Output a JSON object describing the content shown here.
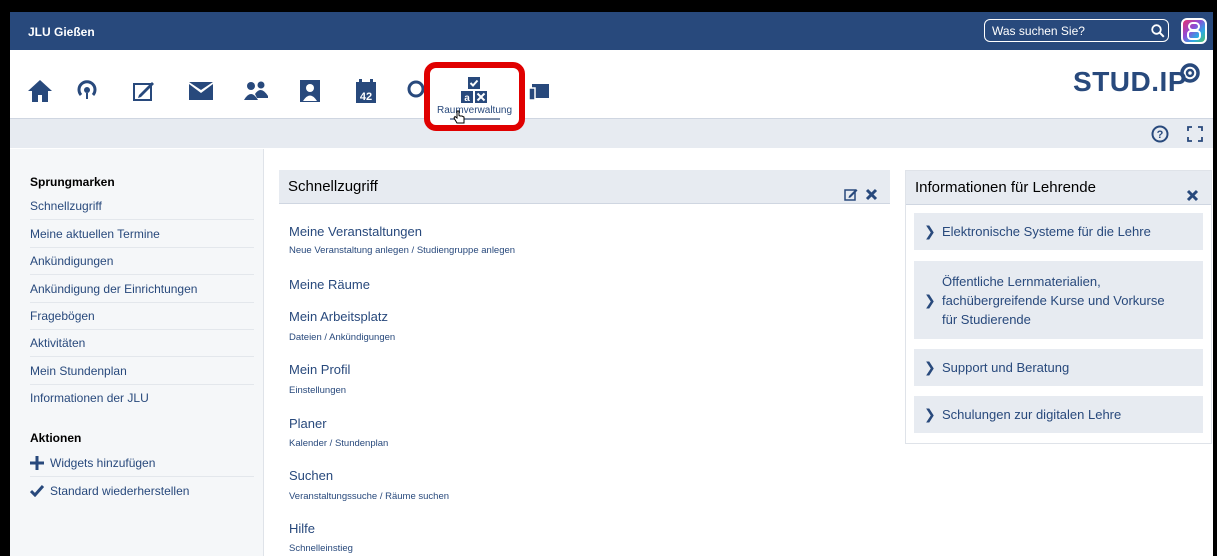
{
  "topbar": {
    "brand": "JLU Gießen",
    "search_placeholder": "Was suchen Sie?"
  },
  "nav": {
    "icons": [
      "home-icon",
      "activity-icon",
      "courses-icon",
      "messages-icon",
      "community-icon",
      "profile-icon",
      "planner-icon",
      "search-icon",
      "resources-icon",
      "tools-icon"
    ],
    "highlighted_label": "Raumverwaltung"
  },
  "logo": {
    "text_a": "STUD",
    "text_b": ".IP"
  },
  "colors": {
    "primary": "#28497c",
    "highlight": "#e00000",
    "panel": "#e7ebf1"
  },
  "sidebar": {
    "jump_heading": "Sprungmarken",
    "jump_items": [
      "Schnellzugriff",
      "Meine aktuellen Termine",
      "Ankündigungen",
      "Ankündigung der Einrichtungen",
      "Fragebögen",
      "Aktivitäten",
      "Mein Stundenplan",
      "Informationen der JLU"
    ],
    "actions_heading": "Aktionen",
    "actions": [
      "Widgets hinzufügen",
      "Standard wiederherstellen"
    ]
  },
  "quicklinks": {
    "title": "Schnellzugriff",
    "items": [
      {
        "title": "Meine Veranstaltungen",
        "sub": "Neue Veranstaltung anlegen / Studiengruppe anlegen"
      },
      {
        "title": "Meine Räume",
        "sub": ""
      },
      {
        "title": "Mein Arbeitsplatz",
        "sub": "Dateien / Ankündigungen"
      },
      {
        "title": "Mein Profil",
        "sub": "Einstellungen"
      },
      {
        "title": "Planer",
        "sub": "Kalender / Stundenplan"
      },
      {
        "title": "Suchen",
        "sub": "Veranstaltungssuche / Räume suchen"
      },
      {
        "title": "Hilfe",
        "sub": "Schnelleinstieg"
      }
    ]
  },
  "info": {
    "title": "Informationen für Lehrende",
    "items": [
      "Elektronische Systeme für die Lehre",
      "Öffentliche Lernmaterialien, fachübergreifende Kurse und Vorkurse für Studierende",
      "Support und Beratung",
      "Schulungen zur digitalen Lehre"
    ]
  }
}
